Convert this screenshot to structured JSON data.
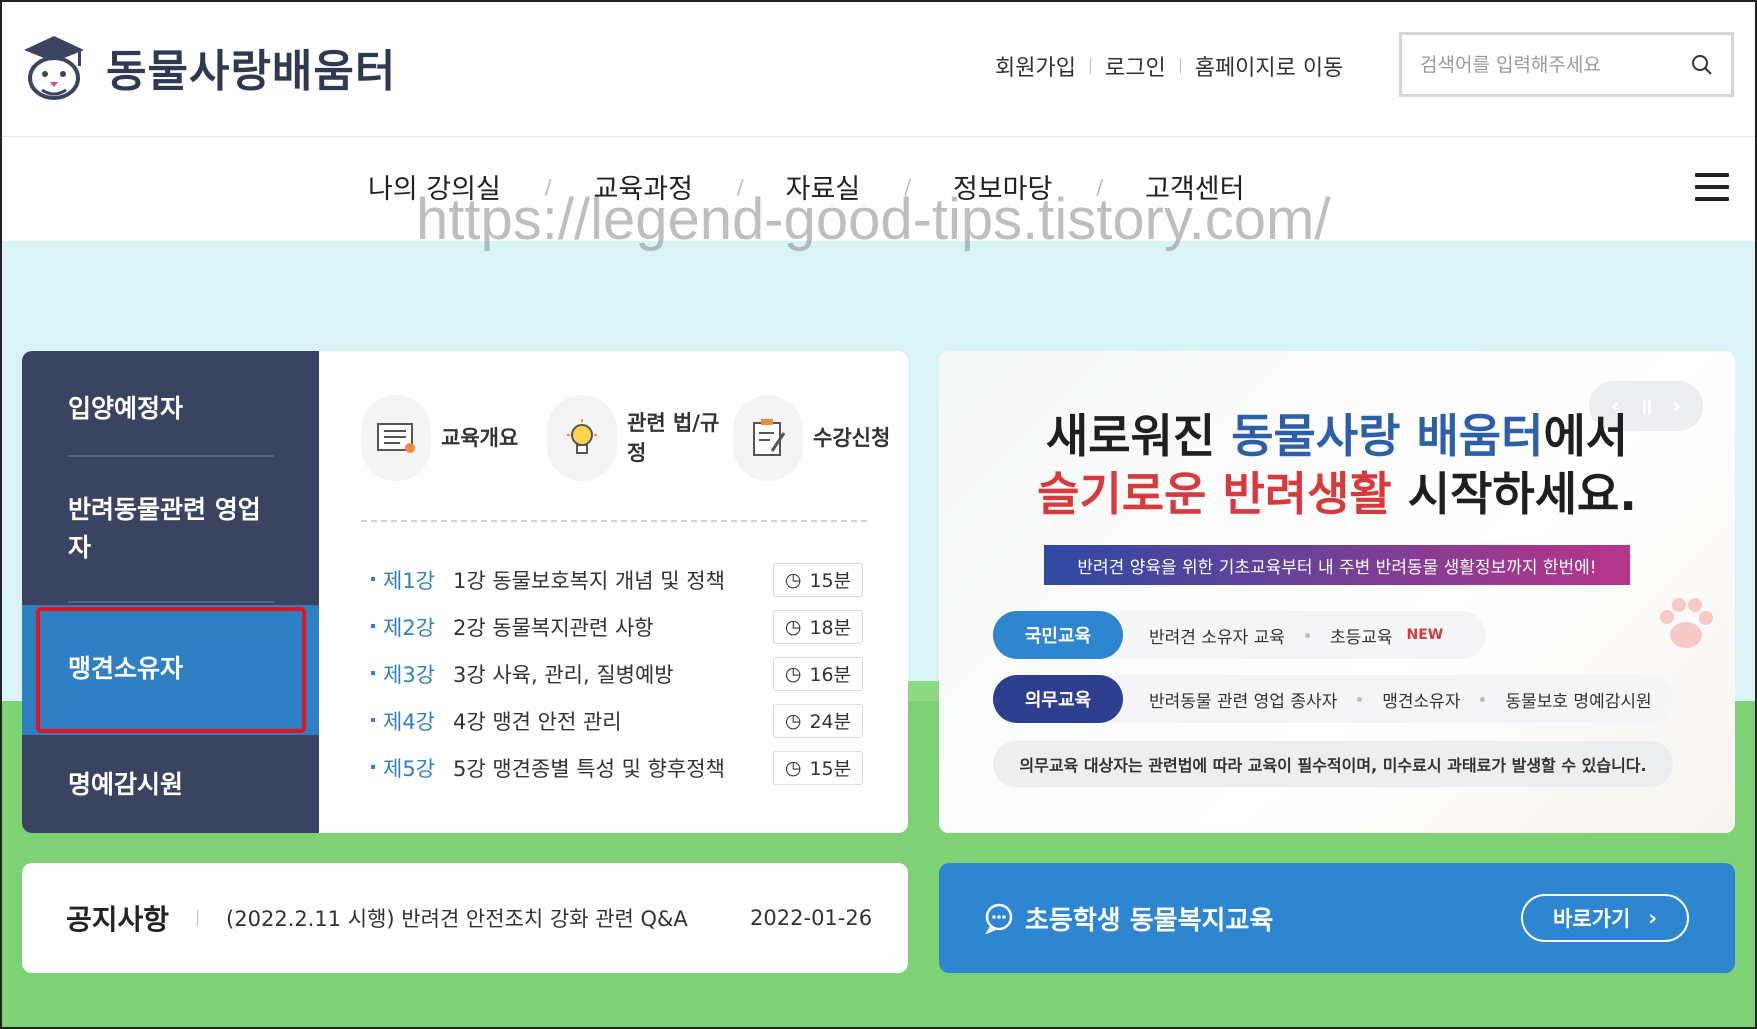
{
  "brand": {
    "name": "동물사랑배움터"
  },
  "util_links": [
    "회원가입",
    "로그인",
    "홈페이지로 이동"
  ],
  "search": {
    "placeholder": "검색어를 입력해주세요"
  },
  "nav": [
    "나의 강의실",
    "교육과정",
    "자료실",
    "정보마당",
    "고객센터"
  ],
  "watermark": "https://legend-good-tips.tistory.com/",
  "sidebar": {
    "items": [
      "입양예정자",
      "반려동물관련 영업자",
      "맹견소유자",
      "명예감시원"
    ],
    "active_index": 2
  },
  "quick_links": [
    {
      "label": "교육개요",
      "icon": "book-icon"
    },
    {
      "label": "관련 법/규정",
      "icon": "lightbulb-icon"
    },
    {
      "label": "수강신청",
      "icon": "form-edit-icon"
    }
  ],
  "lessons": [
    {
      "no": "제1강",
      "title": "1강 동물보호복지 개념 및 정책",
      "time": "15분"
    },
    {
      "no": "제2강",
      "title": "2강 동물복지관련 사항",
      "time": "18분"
    },
    {
      "no": "제3강",
      "title": "3강 사육, 관리, 질병예방",
      "time": "16분"
    },
    {
      "no": "제4강",
      "title": "4강 맹견 안전 관리",
      "time": "24분"
    },
    {
      "no": "제5강",
      "title": "5강 맹견종별 특성 및 향후정책",
      "time": "15분"
    }
  ],
  "banner": {
    "line1_prefix": "새로워진 ",
    "line1_highlight": "동물사랑 배움터",
    "line1_suffix": "에서",
    "line2_highlight": "슬기로운 반려생활",
    "line2_suffix": " 시작하세요.",
    "strip": "반려견 양육을 위한 기초교육부터 내 주변 반려동물 생활정보까지 한번에!",
    "row1": {
      "tag": "국민교육",
      "items": [
        "반려견 소유자 교육",
        "초등교육"
      ],
      "new": "NEW"
    },
    "row2": {
      "tag": "의무교육",
      "items": [
        "반려동물 관련 영업 종사자",
        "맹견소유자",
        "동물보호 명예감시원"
      ]
    },
    "note": "의무교육 대상자는 관련법에 따라 교육이 필수적이며, 미수료시 과태료가 발생할 수 있습니다.",
    "controls": {
      "prev": "‹",
      "pause": "॥",
      "next": "›"
    }
  },
  "notice": {
    "title": "공지사항",
    "text": "(2022.2.11 시행) 반려견 안전조치 강화 관련 Q&A",
    "date": "2022-01-26"
  },
  "elementary": {
    "title": "초등학생 동물복지교육",
    "button": "바로가기"
  },
  "colors": {
    "navy": "#3a4461",
    "active_blue": "#2f7fc4",
    "banner_blue": "#2d86cf",
    "highlight_red": "#e3141c",
    "sky": "#d9f3f7",
    "grass": "#7ed174"
  }
}
